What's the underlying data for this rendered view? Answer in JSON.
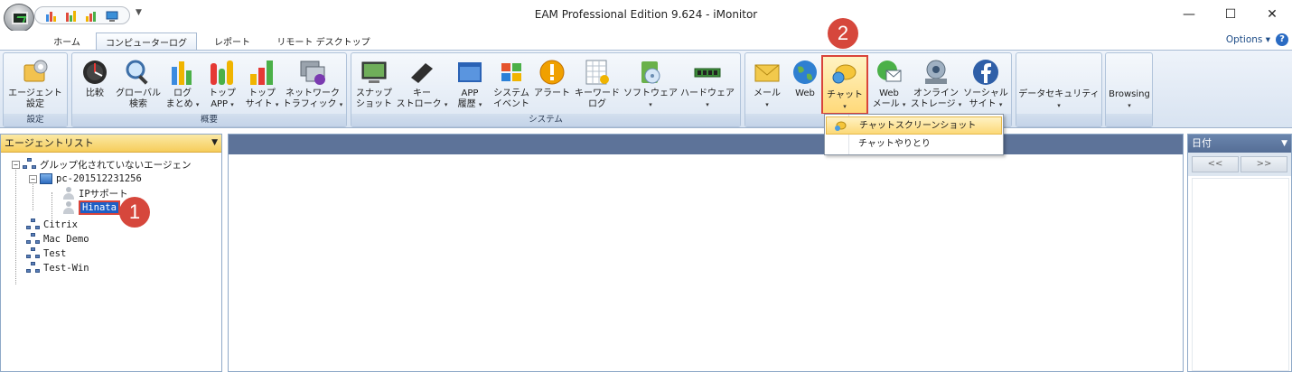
{
  "window": {
    "title": "EAM Professional Edition 9.624 - iMonitor",
    "minimize": "—",
    "maximize": "☐",
    "close": "✕"
  },
  "tabs": [
    {
      "label": "ホーム",
      "active": false
    },
    {
      "label": "コンピューターログ",
      "active": true
    },
    {
      "label": "レポート",
      "active": false
    },
    {
      "label": "リモート デスクトップ",
      "active": false
    }
  ],
  "options_label": "Options",
  "help_label": "?",
  "ribbon": {
    "groups": [
      {
        "label": "設定",
        "buttons": [
          {
            "line1": "エージェント",
            "line2": "設定",
            "arrow": false,
            "icon": "agent-settings-icon"
          }
        ]
      },
      {
        "label": "概要",
        "buttons": [
          {
            "line1": "比較",
            "line2": "",
            "arrow": false,
            "icon": "compare-icon"
          },
          {
            "line1": "グローバル",
            "line2": "検索",
            "arrow": false,
            "icon": "search-icon"
          },
          {
            "line1": "ログ",
            "line2": "まとめ",
            "arrow": true,
            "icon": "log-summary-icon"
          },
          {
            "line1": "トップ",
            "line2": "APP",
            "arrow": true,
            "icon": "top-app-icon"
          },
          {
            "line1": "トップ",
            "line2": "サイト",
            "arrow": true,
            "icon": "top-site-icon"
          },
          {
            "line1": "ネットワーク",
            "line2": "トラフィック",
            "arrow": true,
            "icon": "network-traffic-icon"
          }
        ]
      },
      {
        "label": "システム",
        "buttons": [
          {
            "line1": "スナップ",
            "line2": "ショット",
            "arrow": false,
            "icon": "snapshot-icon"
          },
          {
            "line1": "キー",
            "line2": "ストローク",
            "arrow": true,
            "icon": "keystroke-icon"
          },
          {
            "line1": "APP",
            "line2": "履歴",
            "arrow": true,
            "icon": "app-history-icon"
          },
          {
            "line1": "システム",
            "line2": "イベント",
            "arrow": false,
            "icon": "system-event-icon"
          },
          {
            "line1": "アラート",
            "line2": "",
            "arrow": false,
            "icon": "alert-icon"
          },
          {
            "line1": "キーワード",
            "line2": "ログ",
            "arrow": false,
            "icon": "keyword-log-icon"
          },
          {
            "line1": "ソフトウェア",
            "line2": "",
            "arrow": true,
            "icon": "software-icon"
          },
          {
            "line1": "ハードウェア",
            "line2": "",
            "arrow": true,
            "icon": "hardware-icon"
          }
        ]
      },
      {
        "label": "",
        "buttons": [
          {
            "line1": "メール",
            "line2": "",
            "arrow": true,
            "icon": "mail-icon"
          },
          {
            "line1": "Web",
            "line2": "",
            "arrow": false,
            "icon": "web-icon"
          },
          {
            "line1": "チャット",
            "line2": "",
            "arrow": true,
            "icon": "chat-icon"
          },
          {
            "line1": "Web",
            "line2": "メール",
            "arrow": true,
            "icon": "webmail-icon"
          },
          {
            "line1": "オンライン",
            "line2": "ストレージ",
            "arrow": true,
            "icon": "online-storage-icon"
          },
          {
            "line1": "ソーシャル",
            "line2": "サイト",
            "arrow": true,
            "icon": "social-site-icon"
          }
        ]
      },
      {
        "label": "",
        "buttons": [
          {
            "line1": "データセキュリティ",
            "line2": "",
            "arrow": true,
            "icon": ""
          }
        ]
      },
      {
        "label": "",
        "buttons": [
          {
            "line1": "Browsing",
            "line2": "",
            "arrow": true,
            "icon": ""
          }
        ]
      }
    ]
  },
  "chat_menu": {
    "items": [
      {
        "label": "チャットスクリーンショット",
        "hot": true
      },
      {
        "label": "チャットやりとり",
        "hot": false
      }
    ]
  },
  "agent_list": {
    "title": "エージェントリスト",
    "nodes": {
      "ungrouped": "グルップ化されていないエージェン",
      "pc": "pc-201512231256",
      "ip_support": "IPサポート",
      "hinata": "Hinata",
      "citrix": "Citrix",
      "mac_demo": "Mac Demo",
      "test": "Test",
      "test_win": "Test-Win"
    }
  },
  "date_panel": {
    "title": "日付",
    "prev": "<<",
    "next": ">>"
  },
  "badges": {
    "one": "1",
    "two": "2"
  },
  "colors": {
    "accent_red": "#d6473c",
    "selection_blue": "#1e5fc6",
    "ribbon_bg": "#dde7f3"
  }
}
